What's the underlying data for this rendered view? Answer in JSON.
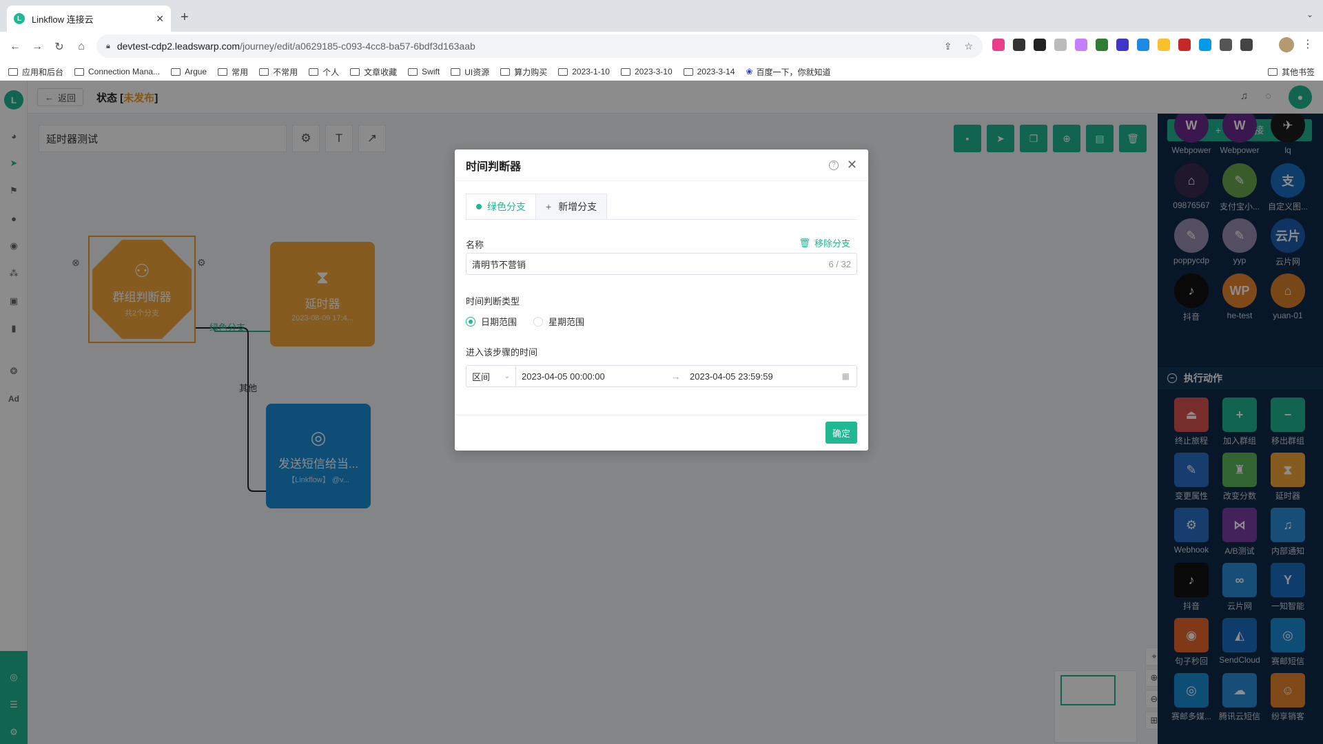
{
  "browser": {
    "tab_title": "Linkflow 连接云",
    "url_host": "devtest-cdp2.leadswarp.com",
    "url_path": "/journey/edit/a0629185-c093-4cc8-ba57-6bdf3d163aab",
    "bookmarks": [
      "应用和后台",
      "Connection Mana...",
      "Argue",
      "常用",
      "不常用",
      "个人",
      "文章收藏",
      "Swift",
      "UI资源",
      "算力购买",
      "2023-1-10",
      "2023-3-10",
      "2023-3-14",
      "百度一下，你就知道"
    ],
    "other_bookmarks": "其他书签"
  },
  "topbar": {
    "back_label": "返回",
    "status_prefix": "状态 [",
    "status_value": "未发布",
    "status_suffix": "]"
  },
  "journey": {
    "name": "延时器测试"
  },
  "canvas": {
    "node_group": {
      "title": "群组判断器",
      "sub": "共2个分支"
    },
    "node_delay": {
      "title": "延时器",
      "sub": "2023-08-09 17:4..."
    },
    "node_sms": {
      "title": "发送短信给当...",
      "sub": "【Linkflow】 @v..."
    },
    "edge_green": "绿色分支",
    "edge_other": "其他"
  },
  "rpanel": {
    "new_connection": "新建连接",
    "channels": [
      {
        "label": "Webpower",
        "color": "#6b2d8f",
        "glyph": "W"
      },
      {
        "label": "Webpower",
        "color": "#6b2d8f",
        "glyph": "W"
      },
      {
        "label": "lq",
        "color": "#1c1c1c",
        "glyph": "✈"
      },
      {
        "label": "09876567",
        "color": "#3a2a50",
        "glyph": "⌂"
      },
      {
        "label": "支付宝小...",
        "color": "#6aa84f",
        "glyph": "✎"
      },
      {
        "label": "自定义图...",
        "color": "#1a6fc4",
        "glyph": "支"
      },
      {
        "label": "poppycdp",
        "color": "#9a8fb5",
        "glyph": "✎"
      },
      {
        "label": "yyp",
        "color": "#9a8fb5",
        "glyph": "✎"
      },
      {
        "label": "云片网",
        "color": "#1e5fb3",
        "glyph": "云片"
      },
      {
        "label": "抖音",
        "color": "#111111",
        "glyph": "♪"
      },
      {
        "label": "he-test",
        "color": "#e8862f",
        "glyph": "WP"
      },
      {
        "label": "yuan-01",
        "color": "#d9822b",
        "glyph": "⌂"
      }
    ],
    "actions_title": "执行动作",
    "actions": [
      {
        "label": "终止旅程",
        "color": "#d9534f",
        "glyph": "⏏"
      },
      {
        "label": "加入群组",
        "color": "#1fb893",
        "glyph": "+"
      },
      {
        "label": "移出群组",
        "color": "#1fb893",
        "glyph": "−"
      },
      {
        "label": "变更属性",
        "color": "#2a6fc9",
        "glyph": "✎"
      },
      {
        "label": "改变分数",
        "color": "#5cb85c",
        "glyph": "♜"
      },
      {
        "label": "延时器",
        "color": "#f2a73b",
        "glyph": "⧗"
      },
      {
        "label": "Webhook",
        "color": "#2a6fc9",
        "glyph": "⚙"
      },
      {
        "label": "A/B测试",
        "color": "#7b3fa6",
        "glyph": "⋈"
      },
      {
        "label": "内部通知",
        "color": "#2a8fd9",
        "glyph": "♫"
      },
      {
        "label": "抖音",
        "color": "#111111",
        "glyph": "♪"
      },
      {
        "label": "云片网",
        "color": "#2a8fd9",
        "glyph": "∞"
      },
      {
        "label": "一知智能",
        "color": "#1a6fc4",
        "glyph": "Y"
      },
      {
        "label": "句子秒回",
        "color": "#e8682f",
        "glyph": "◉"
      },
      {
        "label": "SendCloud",
        "color": "#1a6fc4",
        "glyph": "◭"
      },
      {
        "label": "赛邮短信",
        "color": "#1a8fd8",
        "glyph": "◎"
      },
      {
        "label": "赛邮多媒...",
        "color": "#1a8fd8",
        "glyph": "◎"
      },
      {
        "label": "腾讯云短信",
        "color": "#2a8fd9",
        "glyph": "☁"
      },
      {
        "label": "纷享销客",
        "color": "#e8862f",
        "glyph": "☺"
      }
    ]
  },
  "modal": {
    "title": "时间判断器",
    "tab_active": "绿色分支",
    "tab_add": "新增分支",
    "name_label": "名称",
    "remove_branch": "移除分支",
    "name_value": "清明节不营销",
    "name_count": "6 / 32",
    "type_label": "时间判断类型",
    "type_date": "日期范围",
    "type_week": "星期范围",
    "enter_label": "进入该步骤的时间",
    "range_select": "区间",
    "start_date": "2023-04-05 00:00:00",
    "end_date": "2023-04-05 23:59:59",
    "confirm": "确定"
  }
}
